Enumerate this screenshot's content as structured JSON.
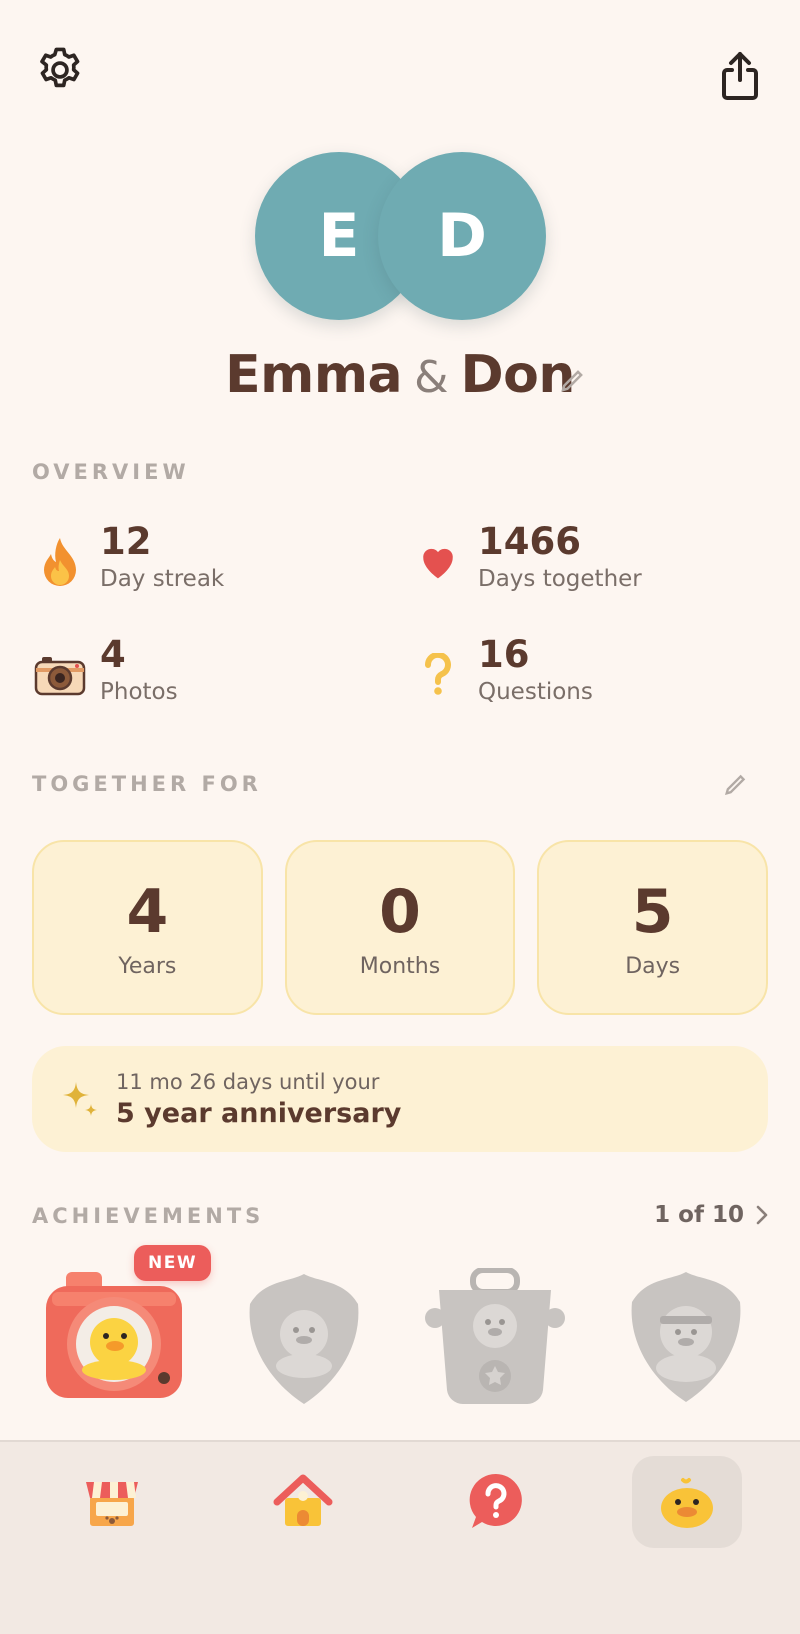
{
  "profile": {
    "initials": [
      "E",
      "D"
    ],
    "name1": "Emma",
    "amp": "&",
    "name2": "Don"
  },
  "overview": {
    "label": "OVERVIEW",
    "stats": [
      {
        "value": "12",
        "label": "Day streak",
        "icon": "fire-icon"
      },
      {
        "value": "1466",
        "label": "Days together",
        "icon": "heart-icon"
      },
      {
        "value": "4",
        "label": "Photos",
        "icon": "camera-icon"
      },
      {
        "value": "16",
        "label": "Questions",
        "icon": "question-icon"
      }
    ]
  },
  "together": {
    "label": "TOGETHER FOR",
    "cards": [
      {
        "value": "4",
        "unit": "Years"
      },
      {
        "value": "0",
        "unit": "Months"
      },
      {
        "value": "5",
        "unit": "Days"
      }
    ]
  },
  "anniversary": {
    "countdown": "11 mo 26 days until your",
    "title": "5 year anniversary"
  },
  "achievements": {
    "label": "ACHIEVEMENTS",
    "count": "1 of 10",
    "new_tag": "NEW"
  },
  "colors": {
    "background": "#fdf6f1",
    "avatar": "#6fabb2",
    "text": "#5b3a2e",
    "card": "#fdf1d4",
    "accent_red": "#ec5d5b"
  }
}
